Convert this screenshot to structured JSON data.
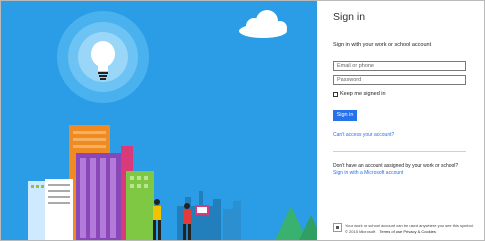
{
  "illustration": {
    "sky_color": "#2a9de6",
    "icons": [
      "lightbulb-icon",
      "cloud-icon"
    ]
  },
  "signin": {
    "title": "Sign in",
    "instruction": "Sign in with your work or school account",
    "email_placeholder": "Email or phone",
    "password_placeholder": "Password",
    "keep_signed_in": "Keep me signed in",
    "button": "Sign in",
    "cant_access": "Can't access your account?",
    "no_account": "Don't have an account assigned by your work or school?",
    "ms_account_link": "Sign in with a Microsoft account",
    "accent_color": "#2672ec"
  },
  "footer": {
    "notice": "Your work or school account can be used anywhere you see this symbol.",
    "copyright": "© 2015 Microsoft",
    "terms": "Terms of use",
    "privacy": "Privacy & Cookies"
  }
}
